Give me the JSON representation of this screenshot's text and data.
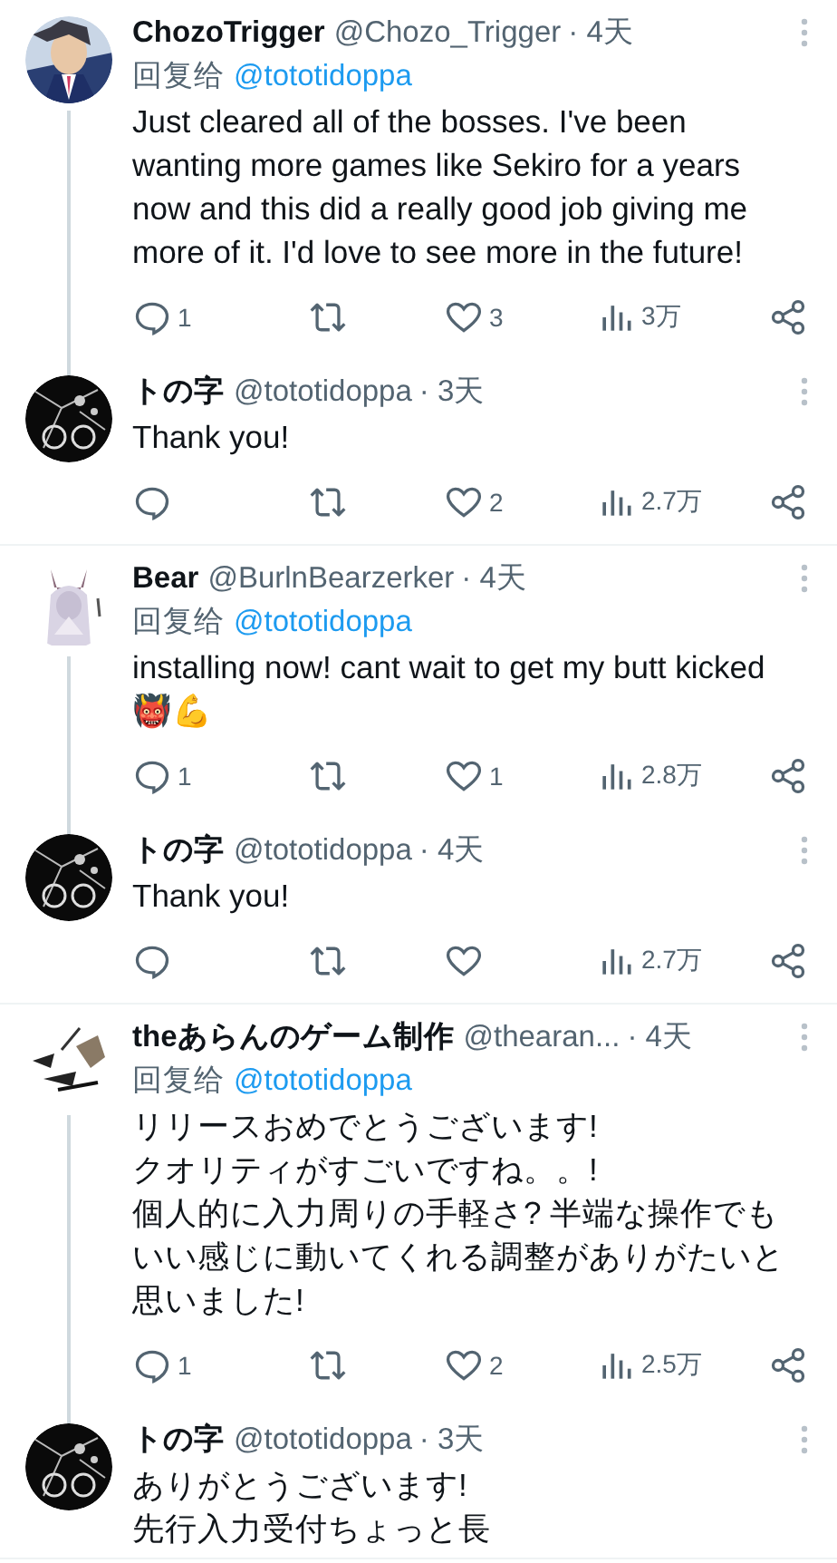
{
  "groups": [
    {
      "tweets": [
        {
          "name": "ChozoTrigger",
          "handle": "@Chozo_Trigger",
          "time": "· 4天",
          "reply_label": "回复给",
          "reply_to": "@tototidoppa",
          "text": "Just cleared all of the bosses. I've been wanting more games like Sekiro for a years now and this did a really good job giving me more of it. I'd love to see more in the future!",
          "thread": true,
          "actions": {
            "replies": "1",
            "likes": "3",
            "views": "3万"
          }
        },
        {
          "name": "トの字",
          "handle": "@tototidoppa",
          "time": "· 3天",
          "text": "Thank you!",
          "thread": false,
          "actions": {
            "likes": "2",
            "views": "2.7万"
          }
        }
      ]
    },
    {
      "tweets": [
        {
          "name": "Bear",
          "handle": "@BurlnBearzerker",
          "time": "· 4天",
          "reply_label": "回复给",
          "reply_to": "@tototidoppa",
          "text": "installing now! cant wait to get my butt kicked 👹💪",
          "thread": true,
          "actions": {
            "replies": "1",
            "likes": "1",
            "views": "2.8万"
          }
        },
        {
          "name": "トの字",
          "handle": "@tototidoppa",
          "time": "· 4天",
          "text": "Thank you!",
          "thread": false,
          "actions": {
            "views": "2.7万"
          }
        }
      ]
    },
    {
      "tweets": [
        {
          "name": "theあらんのゲーム制作",
          "handle": "@thearan...",
          "time": "· 4天",
          "reply_label": "回复给",
          "reply_to": "@tototidoppa",
          "text": "リリースおめでとうございます!\nクオリティがすごいですね。。!\n個人的に入力周りの手軽さ? 半端な操作でもいい感じに動いてくれる調整がありがたいと思いました!",
          "thread": true,
          "actions": {
            "replies": "1",
            "likes": "2",
            "views": "2.5万"
          }
        },
        {
          "name": "トの字",
          "handle": "@tototidoppa",
          "time": "· 3天",
          "text": "ありがとうございます!\n先行入力受付ちょっと長",
          "thread": false
        }
      ]
    }
  ]
}
